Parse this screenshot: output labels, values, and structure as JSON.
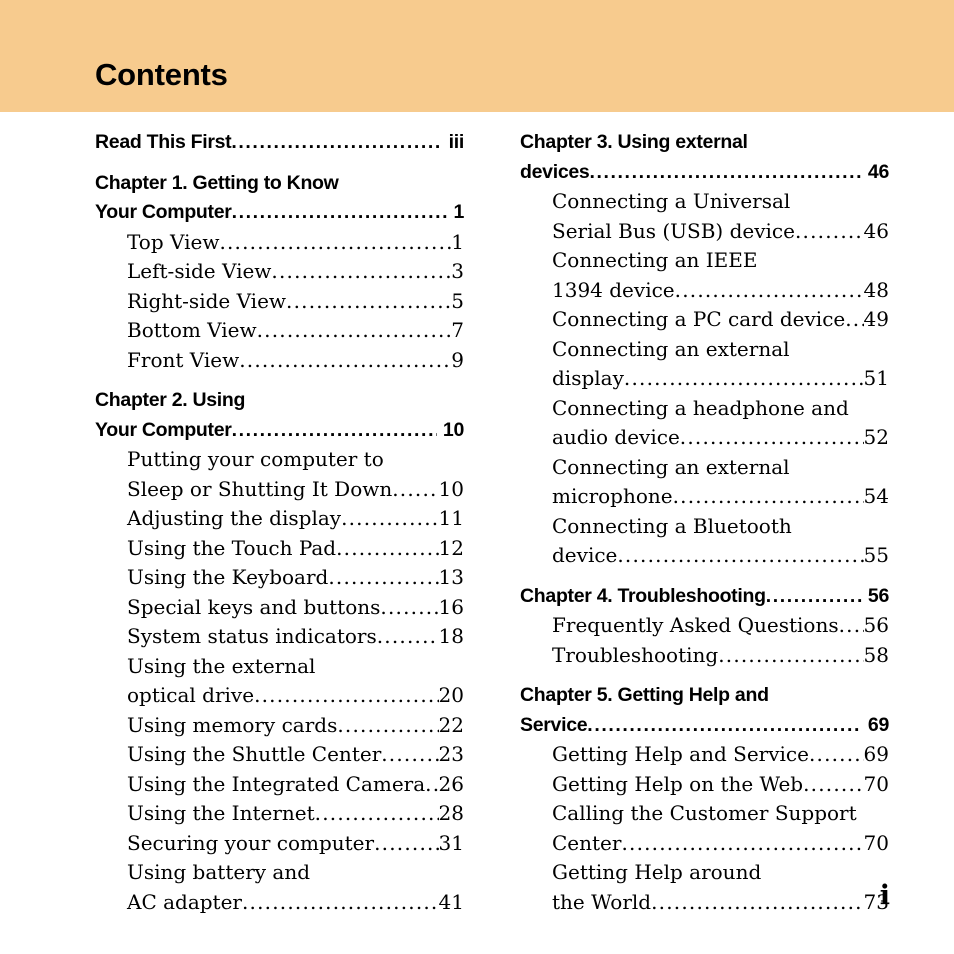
{
  "header": {
    "title": "Contents",
    "band_color": "#f7cb8e"
  },
  "footer": {
    "folio": "i"
  },
  "columns": {
    "left": [
      {
        "type": "chapter",
        "lines": [
          "Read This First"
        ],
        "page": "iii"
      },
      {
        "type": "chapter",
        "lines": [
          "Chapter 1. Getting to Know",
          "Your Computer"
        ],
        "page": "1"
      },
      {
        "type": "sub",
        "lines": [
          "Top View"
        ],
        "page": "1"
      },
      {
        "type": "sub",
        "lines": [
          "Left-side View"
        ],
        "page": "3"
      },
      {
        "type": "sub",
        "lines": [
          "Right-side View"
        ],
        "page": "5"
      },
      {
        "type": "sub",
        "lines": [
          "Bottom View"
        ],
        "page": "7"
      },
      {
        "type": "sub",
        "lines": [
          "Front View"
        ],
        "page": "9"
      },
      {
        "type": "chapter",
        "lines": [
          "Chapter 2. Using",
          "Your Computer"
        ],
        "page": "10"
      },
      {
        "type": "sub",
        "lines": [
          "Putting your computer to",
          "Sleep or Shutting It Down"
        ],
        "page": "10"
      },
      {
        "type": "sub",
        "lines": [
          "Adjusting the display"
        ],
        "page": "11"
      },
      {
        "type": "sub",
        "lines": [
          "Using the Touch Pad"
        ],
        "page": "12"
      },
      {
        "type": "sub",
        "lines": [
          "Using the Keyboard"
        ],
        "page": "13"
      },
      {
        "type": "sub",
        "lines": [
          "Special keys and buttons"
        ],
        "page": "16"
      },
      {
        "type": "sub",
        "lines": [
          "System status indicators"
        ],
        "page": "18"
      },
      {
        "type": "sub",
        "lines": [
          "Using the external",
          "optical drive"
        ],
        "page": "20"
      },
      {
        "type": "sub",
        "lines": [
          "Using memory cards"
        ],
        "page": "22"
      },
      {
        "type": "sub",
        "lines": [
          "Using the Shuttle Center"
        ],
        "page": "23"
      },
      {
        "type": "sub",
        "lines": [
          "Using the Integrated Camera"
        ],
        "page": "26"
      },
      {
        "type": "sub",
        "lines": [
          "Using the Internet"
        ],
        "page": "28"
      },
      {
        "type": "sub",
        "lines": [
          "Securing your computer"
        ],
        "page": "31"
      },
      {
        "type": "sub",
        "lines": [
          "Using battery and",
          "AC adapter"
        ],
        "page": "41"
      }
    ],
    "right": [
      {
        "type": "chapter",
        "lines": [
          "Chapter 3. Using external",
          "devices"
        ],
        "page": "46"
      },
      {
        "type": "sub",
        "lines": [
          "Connecting a Universal",
          "Serial Bus (USB) device"
        ],
        "page": "46"
      },
      {
        "type": "sub",
        "lines": [
          "Connecting an IEEE",
          "1394 device"
        ],
        "page": "48"
      },
      {
        "type": "sub",
        "lines": [
          "Connecting a PC card device"
        ],
        "page": "49"
      },
      {
        "type": "sub",
        "lines": [
          "Connecting an external",
          "display"
        ],
        "page": "51"
      },
      {
        "type": "sub",
        "lines": [
          "Connecting a headphone and",
          "audio device"
        ],
        "page": "52"
      },
      {
        "type": "sub",
        "lines": [
          "Connecting an external",
          "microphone"
        ],
        "page": "54"
      },
      {
        "type": "sub",
        "lines": [
          "Connecting a Bluetooth",
          "device"
        ],
        "page": "55"
      },
      {
        "type": "chapter",
        "lines": [
          "Chapter 4. Troubleshooting"
        ],
        "page": "56"
      },
      {
        "type": "sub",
        "lines": [
          "Frequently Asked Questions"
        ],
        "page": "56"
      },
      {
        "type": "sub",
        "lines": [
          "Troubleshooting"
        ],
        "page": "58"
      },
      {
        "type": "chapter",
        "lines": [
          "Chapter 5. Getting Help and",
          "Service"
        ],
        "page": "69"
      },
      {
        "type": "sub",
        "lines": [
          "Getting Help and Service"
        ],
        "page": "69"
      },
      {
        "type": "sub",
        "lines": [
          "Getting Help on the Web"
        ],
        "page": "70"
      },
      {
        "type": "sub",
        "lines": [
          "Calling the Customer Support",
          "Center"
        ],
        "page": "70"
      },
      {
        "type": "sub",
        "lines": [
          "Getting Help around",
          "the World"
        ],
        "page": "73"
      }
    ]
  }
}
